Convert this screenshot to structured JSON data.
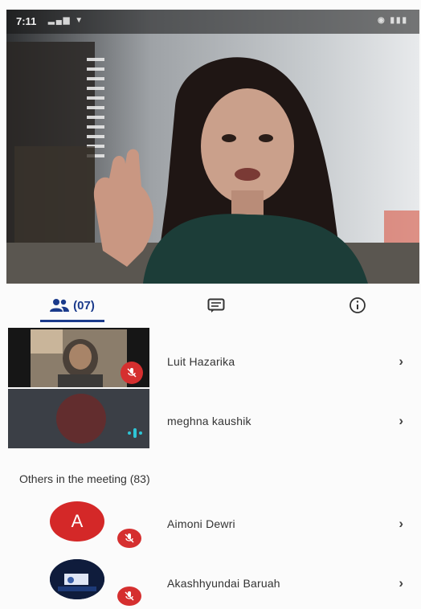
{
  "status_bar": {
    "time": "7:11",
    "left_icons": "signal-icons",
    "right_icons": "battery-icons"
  },
  "video": {
    "description_icon": "main-speaker-video"
  },
  "tabs": {
    "people_count": "(07)",
    "people_icon": "people-icon",
    "chat_icon": "chat-icon",
    "info_icon": "info-icon"
  },
  "participants": [
    {
      "name": "Luit Hazarika",
      "status_icon": "mic-off-icon"
    },
    {
      "name": "meghna kaushik",
      "status_icon": "speaking-icon"
    }
  ],
  "others_section": {
    "label": "Others in the meeting (83)"
  },
  "others": [
    {
      "initial": "A",
      "name": "Aimoni Dewri",
      "status_icon": "mic-off-icon"
    },
    {
      "name": "Akashhyundai Baruah",
      "status_icon": "mic-off-icon"
    }
  ],
  "colors": {
    "accent_blue": "#1b3b8c",
    "mic_off_red": "#d52f2f",
    "avatar_red": "#d42828",
    "speaking_teal": "#2ec6d6"
  }
}
